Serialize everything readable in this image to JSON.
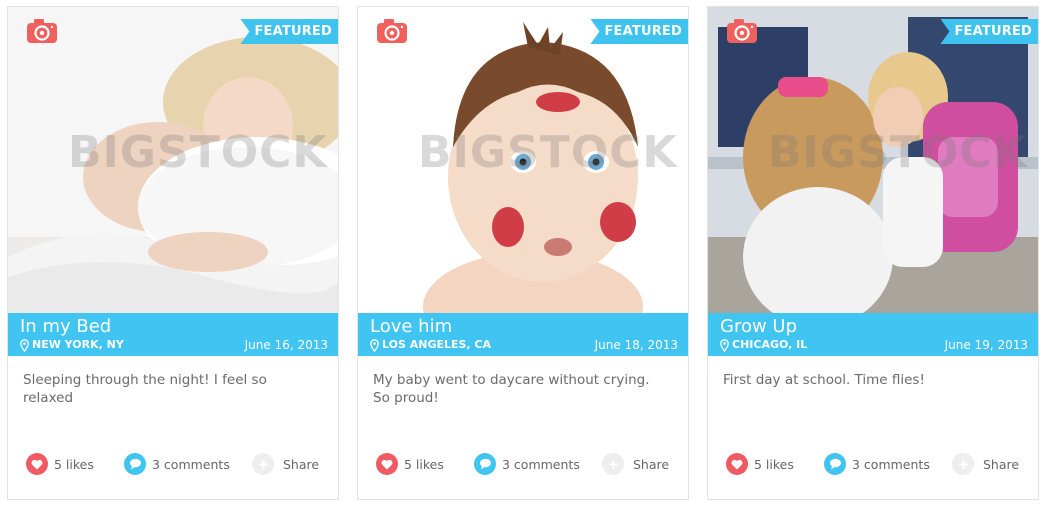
{
  "featured_label": "FEATURED",
  "watermark": "BIGSTOCK",
  "cards": [
    {
      "title": "In my Bed",
      "location": "NEW YORK, NY",
      "date": "June 16, 2013",
      "text": "Sleeping through the night! I feel so relaxed",
      "likes": "5 likes",
      "comments": "3 comments",
      "share": "Share"
    },
    {
      "title": "Love him",
      "location": "LOS ANGELES, CA",
      "date": "June 18, 2013",
      "text": "My baby went to daycare without crying. So proud!",
      "likes": "5 likes",
      "comments": "3 comments",
      "share": "Share"
    },
    {
      "title": "Grow Up",
      "location": "CHICAGO, IL",
      "date": "June 19, 2013",
      "text": "First day at school. Time flies!",
      "likes": "5 likes",
      "comments": "3 comments",
      "share": "Share"
    }
  ],
  "colors": {
    "accent_blue": "#40c4f1",
    "like_red": "#ef5a63",
    "camera_red": "#f0605d"
  },
  "icons": [
    "camera-icon",
    "location-pin-icon",
    "heart-icon",
    "comment-icon",
    "share-icon"
  ]
}
